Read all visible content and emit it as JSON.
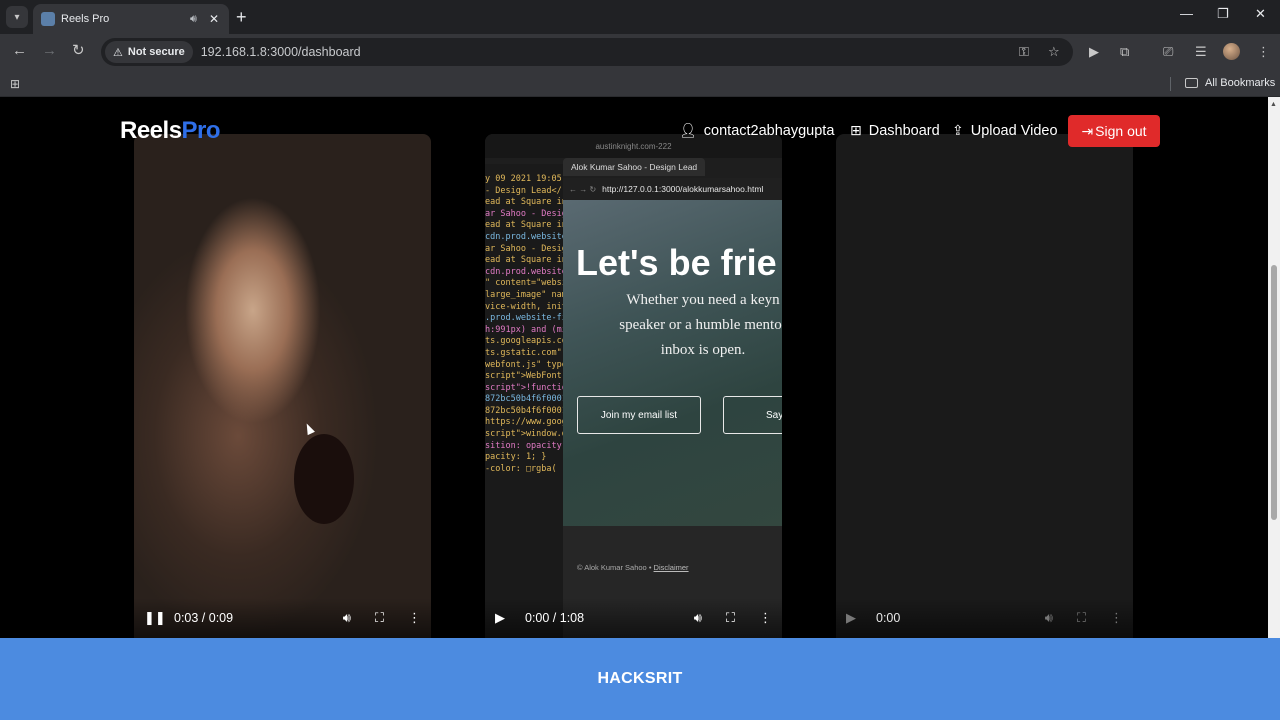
{
  "browser": {
    "tab_title": "Reels Pro",
    "new_tab": "+",
    "security_label": "Not secure",
    "url": "192.168.1.8:3000/dashboard",
    "all_bookmarks": "All Bookmarks"
  },
  "app": {
    "logo_main": "Reels",
    "logo_accent": "Pro",
    "accent_color": "#2f6fe8",
    "signout_color": "#e02a2a",
    "footer_color": "#4c8be0",
    "nav": {
      "user": "contact2abhaygupta",
      "dashboard": "Dashboard",
      "upload": "Upload Video",
      "signout": "Sign out"
    },
    "videos": [
      {
        "state": "playing",
        "time": "0:03 / 0:09"
      },
      {
        "state": "paused",
        "time": "0:00 / 1:08",
        "content": {
          "top_url": "austinknight.com-222",
          "tab": "Alok Kumar Sahoo - Design Lead",
          "address": "http://127.0.0.1:3000/alokkumarsahoo.html",
          "hero": "Let's be frie",
          "subtitle_1": "Whether you need a keyn",
          "subtitle_2": "speaker or a humble mentor",
          "subtitle_3": "inbox is open.",
          "button_1": "Join my email list",
          "button_2": "Say",
          "footer_text": "© Alok Kumar Sahoo •",
          "footer_link": "Disclaimer",
          "code_lines": [
            "y 09 2021 19:05:",
            "- Design Lead</",
            "ead at Square in",
            "ar Sahoo - Desig",
            "ead at Square in",
            "cdn.prod.website",
            "ar Sahoo - Desig",
            "ead at Square in",
            "cdn.prod.website",
            "\" content=\"websi",
            "large_image\" nam",
            "vice-width, init",
            ".prod.website-fi",
            "h:991px) and (mi",
            "ts.googleapis.co",
            "ts.gstatic.com\"",
            "webfont.js\" type",
            "script\">WebFont.",
            "script\">!functio",
            "872bc50b4f6f0001",
            "872bc50b4f6f0001",
            "https://www.googl",
            "script\">window.d",
            "sition: opacity",
            "pacity: 1; }",
            "-color: □rgba("
          ]
        }
      },
      {
        "state": "empty",
        "time": "0:00"
      }
    ],
    "footer_text": "HACKSRIT"
  }
}
